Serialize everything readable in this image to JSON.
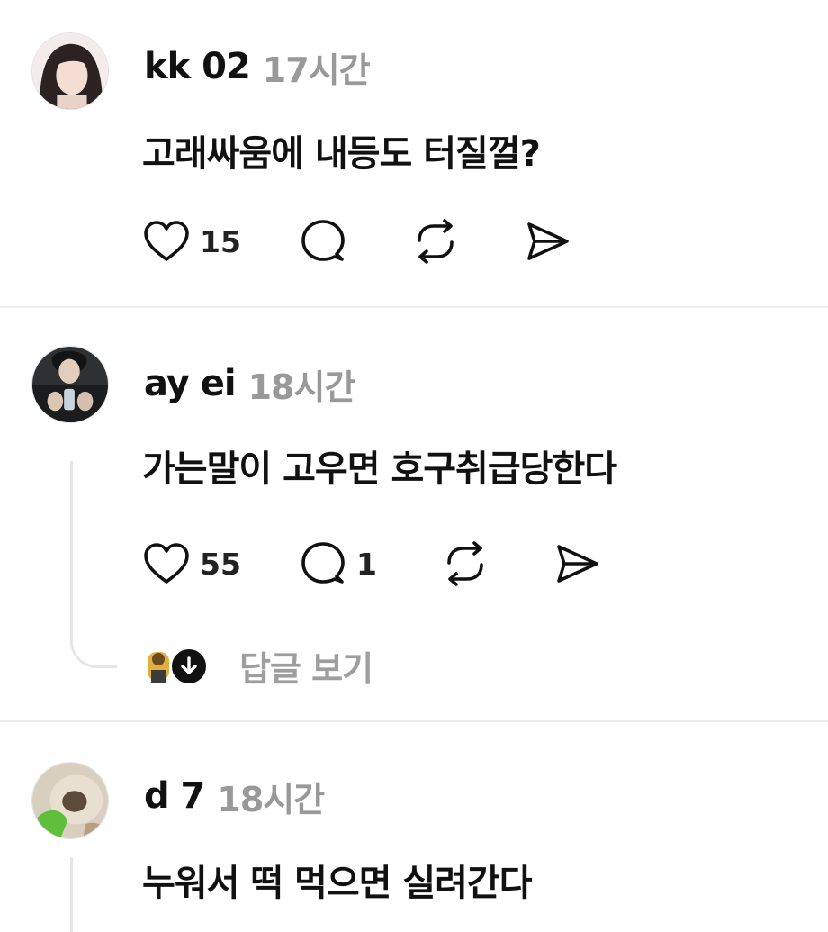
{
  "posts": [
    {
      "username": "kk         02",
      "time": "17시간",
      "text": "고래싸움에 내등도 터질껄?",
      "likes": "15",
      "comments": "",
      "icons": [
        "heart-icon",
        "comment-icon",
        "repost-icon",
        "share-icon"
      ]
    },
    {
      "username": "ay              ei",
      "time": "18시간",
      "text": "가는말이 고우면 호구취급당한다",
      "likes": "55",
      "comments": "1",
      "replies_label": "답글 보기",
      "icons": [
        "heart-icon",
        "comment-icon",
        "repost-icon",
        "share-icon"
      ]
    },
    {
      "username": "d             7",
      "time": "18시간",
      "text": "누워서 떡 먹으면 실려간다"
    }
  ],
  "colors": {
    "text": "#111111",
    "muted": "#999999",
    "divider": "#ececec",
    "thread": "#e6e6e6"
  }
}
